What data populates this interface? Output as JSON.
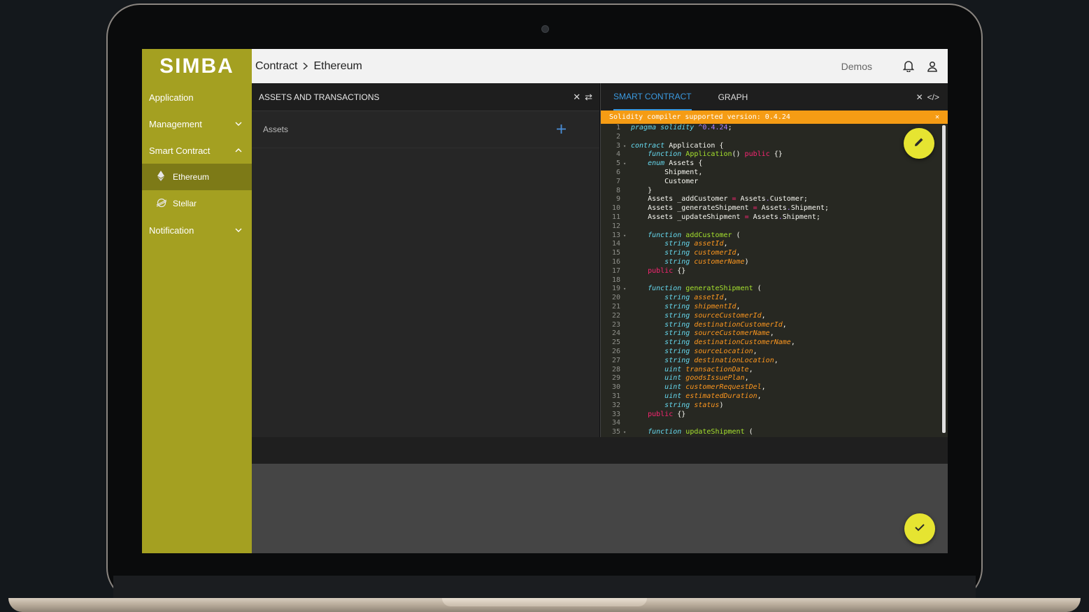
{
  "app": {
    "logo": "SIMBA"
  },
  "sidebar": {
    "items": [
      {
        "label": "Application"
      },
      {
        "label": "Management"
      },
      {
        "label": "Smart Contract"
      },
      {
        "label": "Notification"
      }
    ],
    "sub_items": [
      {
        "label": "Ethereum",
        "icon": "ethereum-icon",
        "active": true
      },
      {
        "label": "Stellar",
        "icon": "stellar-icon",
        "active": false
      }
    ]
  },
  "header": {
    "breadcrumb": [
      "Contract",
      "Ethereum"
    ],
    "demos_label": "Demos",
    "icons": [
      "bell-icon",
      "user-icon"
    ]
  },
  "left_panel": {
    "title": "ASSETS AND TRANSACTIONS",
    "assets_label": "Assets"
  },
  "right_panel": {
    "tabs": [
      {
        "label": "SMART CONTRACT",
        "active": true
      },
      {
        "label": "GRAPH",
        "active": false
      }
    ],
    "banner": "Solidity compiler supported version: 0.4.24",
    "code_lines": [
      "pragma solidity ^0.4.24;",
      "",
      "contract Application {",
      "    function Application() public {}",
      "    enum Assets {",
      "        Shipment,",
      "        Customer",
      "    }",
      "    Assets _addCustomer = Assets.Customer;",
      "    Assets _generateShipment = Assets.Shipment;",
      "    Assets _updateShipment = Assets.Shipment;",
      "",
      "    function addCustomer (",
      "        string assetId,",
      "        string customerId,",
      "        string customerName)",
      "    public {}",
      "",
      "    function generateShipment (",
      "        string assetId,",
      "        string shipmentId,",
      "        string sourceCustomerId,",
      "        string destinationCustomerId,",
      "        string sourceCustomerName,",
      "        string destinationCustomerName,",
      "        string sourceLocation,",
      "        string destinationLocation,",
      "        uint transactionDate,",
      "        uint goodsIssuePlan,",
      "        uint customerRequestDel,",
      "        uint estimatedDuration,",
      "        string status)",
      "    public {}",
      "",
      "    function updateShipment ("
    ],
    "fold_lines": [
      3,
      5,
      13,
      19,
      35
    ]
  },
  "colors": {
    "sidebar": "#a4a021",
    "sidebar_active": "#7d7a17",
    "accent_blue": "#3b9ae1",
    "banner": "#f59c14",
    "fab": "#e6e431"
  }
}
